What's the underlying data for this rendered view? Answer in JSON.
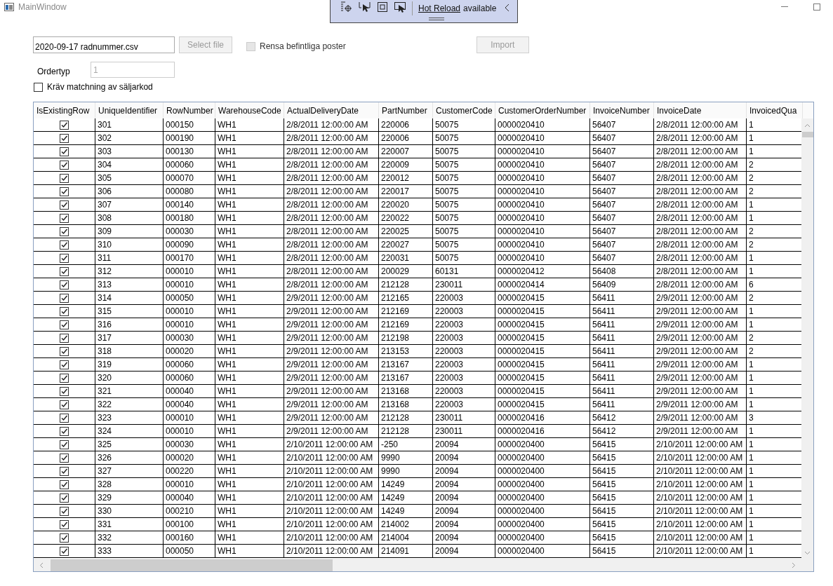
{
  "window": {
    "title": "MainWindow"
  },
  "hot_reload": {
    "link": "Hot Reload",
    "text": "available"
  },
  "file_box": {
    "lines": [
      "2020-09-17 radnummer.csv"
    ]
  },
  "select_button": {
    "label": "Select file",
    "disabled": true
  },
  "clear_option": {
    "label": "Rensa befintliga poster",
    "checked": false,
    "disabled": true
  },
  "import_button": {
    "label": "Import",
    "disabled": true
  },
  "order_type": {
    "label": "Ordertyp",
    "value": "1",
    "disabled": true
  },
  "match_option": {
    "label": "Kräv matchning av säljarkod",
    "checked": false
  },
  "table": {
    "columns": [
      "IsExistingRow",
      "UniqueIdentifier",
      "RowNumber",
      "WarehouseCode",
      "ActualDeliveryDate",
      "PartNumber",
      "CustomerCode",
      "CustomerOrderNumber",
      "InvoiceNumber",
      "InvoiceDate",
      "InvoicedQua"
    ],
    "rows": [
      {
        "checked": true,
        "cells": [
          "",
          "301",
          "000150",
          "WH1",
          "2/8/2011 12:00:00 AM",
          "220006",
          "50075",
          "0000020410",
          "56407",
          "2/8/2011 12:00:00 AM",
          "1"
        ]
      },
      {
        "checked": true,
        "cells": [
          "",
          "302",
          "000190",
          "WH1",
          "2/8/2011 12:00:00 AM",
          "220006",
          "50075",
          "0000020410",
          "56407",
          "2/8/2011 12:00:00 AM",
          "1"
        ]
      },
      {
        "checked": true,
        "cells": [
          "",
          "303",
          "000130",
          "WH1",
          "2/8/2011 12:00:00 AM",
          "220007",
          "50075",
          "0000020410",
          "56407",
          "2/8/2011 12:00:00 AM",
          "1"
        ]
      },
      {
        "checked": true,
        "cells": [
          "",
          "304",
          "000060",
          "WH1",
          "2/8/2011 12:00:00 AM",
          "220009",
          "50075",
          "0000020410",
          "56407",
          "2/8/2011 12:00:00 AM",
          "2"
        ]
      },
      {
        "checked": true,
        "cells": [
          "",
          "305",
          "000070",
          "WH1",
          "2/8/2011 12:00:00 AM",
          "220012",
          "50075",
          "0000020410",
          "56407",
          "2/8/2011 12:00:00 AM",
          "2"
        ]
      },
      {
        "checked": true,
        "cells": [
          "",
          "306",
          "000080",
          "WH1",
          "2/8/2011 12:00:00 AM",
          "220017",
          "50075",
          "0000020410",
          "56407",
          "2/8/2011 12:00:00 AM",
          "2"
        ]
      },
      {
        "checked": true,
        "cells": [
          "",
          "307",
          "000140",
          "WH1",
          "2/8/2011 12:00:00 AM",
          "220020",
          "50075",
          "0000020410",
          "56407",
          "2/8/2011 12:00:00 AM",
          "1"
        ]
      },
      {
        "checked": true,
        "cells": [
          "",
          "308",
          "000180",
          "WH1",
          "2/8/2011 12:00:00 AM",
          "220022",
          "50075",
          "0000020410",
          "56407",
          "2/8/2011 12:00:00 AM",
          "1"
        ]
      },
      {
        "checked": true,
        "cells": [
          "",
          "309",
          "000030",
          "WH1",
          "2/8/2011 12:00:00 AM",
          "220025",
          "50075",
          "0000020410",
          "56407",
          "2/8/2011 12:00:00 AM",
          "2"
        ]
      },
      {
        "checked": true,
        "cells": [
          "",
          "310",
          "000090",
          "WH1",
          "2/8/2011 12:00:00 AM",
          "220027",
          "50075",
          "0000020410",
          "56407",
          "2/8/2011 12:00:00 AM",
          "2"
        ]
      },
      {
        "checked": true,
        "cells": [
          "",
          "311",
          "000170",
          "WH1",
          "2/8/2011 12:00:00 AM",
          "220031",
          "50075",
          "0000020410",
          "56407",
          "2/8/2011 12:00:00 AM",
          "1"
        ]
      },
      {
        "checked": true,
        "cells": [
          "",
          "312",
          "000010",
          "WH1",
          "2/8/2011 12:00:00 AM",
          "200029",
          "60131",
          "0000020412",
          "56408",
          "2/8/2011 12:00:00 AM",
          "1"
        ]
      },
      {
        "checked": true,
        "cells": [
          "",
          "313",
          "000010",
          "WH1",
          "2/8/2011 12:00:00 AM",
          "212128",
          "230011",
          "0000020414",
          "56409",
          "2/8/2011 12:00:00 AM",
          "6"
        ]
      },
      {
        "checked": true,
        "cells": [
          "",
          "314",
          "000050",
          "WH1",
          "2/9/2011 12:00:00 AM",
          "212165",
          "220003",
          "0000020415",
          "56411",
          "2/9/2011 12:00:00 AM",
          "2"
        ]
      },
      {
        "checked": true,
        "cells": [
          "",
          "315",
          "000010",
          "WH1",
          "2/9/2011 12:00:00 AM",
          "212169",
          "220003",
          "0000020415",
          "56411",
          "2/9/2011 12:00:00 AM",
          "1"
        ]
      },
      {
        "checked": true,
        "cells": [
          "",
          "316",
          "000010",
          "WH1",
          "2/9/2011 12:00:00 AM",
          "212169",
          "220003",
          "0000020415",
          "56411",
          "2/9/2011 12:00:00 AM",
          "1"
        ]
      },
      {
        "checked": true,
        "cells": [
          "",
          "317",
          "000030",
          "WH1",
          "2/9/2011 12:00:00 AM",
          "212198",
          "220003",
          "0000020415",
          "56411",
          "2/9/2011 12:00:00 AM",
          "2"
        ]
      },
      {
        "checked": true,
        "cells": [
          "",
          "318",
          "000020",
          "WH1",
          "2/9/2011 12:00:00 AM",
          "213153",
          "220003",
          "0000020415",
          "56411",
          "2/9/2011 12:00:00 AM",
          "2"
        ]
      },
      {
        "checked": true,
        "cells": [
          "",
          "319",
          "000060",
          "WH1",
          "2/9/2011 12:00:00 AM",
          "213167",
          "220003",
          "0000020415",
          "56411",
          "2/9/2011 12:00:00 AM",
          "1"
        ]
      },
      {
        "checked": true,
        "cells": [
          "",
          "320",
          "000060",
          "WH1",
          "2/9/2011 12:00:00 AM",
          "213167",
          "220003",
          "0000020415",
          "56411",
          "2/9/2011 12:00:00 AM",
          "1"
        ]
      },
      {
        "checked": true,
        "cells": [
          "",
          "321",
          "000040",
          "WH1",
          "2/9/2011 12:00:00 AM",
          "213168",
          "220003",
          "0000020415",
          "56411",
          "2/9/2011 12:00:00 AM",
          "1"
        ]
      },
      {
        "checked": true,
        "cells": [
          "",
          "322",
          "000040",
          "WH1",
          "2/9/2011 12:00:00 AM",
          "213168",
          "220003",
          "0000020415",
          "56411",
          "2/9/2011 12:00:00 AM",
          "1"
        ]
      },
      {
        "checked": true,
        "cells": [
          "",
          "323",
          "000010",
          "WH1",
          "2/9/2011 12:00:00 AM",
          "212128",
          "230011",
          "0000020416",
          "56412",
          "2/9/2011 12:00:00 AM",
          "3"
        ]
      },
      {
        "checked": true,
        "cells": [
          "",
          "324",
          "000010",
          "WH1",
          "2/9/2011 12:00:00 AM",
          "212128",
          "230011",
          "0000020416",
          "56412",
          "2/9/2011 12:00:00 AM",
          "1"
        ]
      },
      {
        "checked": true,
        "cells": [
          "",
          "325",
          "000030",
          "WH1",
          "2/10/2011 12:00:00 AM",
          "-250",
          "20094",
          "0000020400",
          "56415",
          "2/10/2011 12:00:00 AM",
          "1"
        ]
      },
      {
        "checked": true,
        "cells": [
          "",
          "326",
          "000020",
          "WH1",
          "2/10/2011 12:00:00 AM",
          "9990",
          "20094",
          "0000020400",
          "56415",
          "2/10/2011 12:00:00 AM",
          "1"
        ]
      },
      {
        "checked": true,
        "cells": [
          "",
          "327",
          "000220",
          "WH1",
          "2/10/2011 12:00:00 AM",
          "9990",
          "20094",
          "0000020400",
          "56415",
          "2/10/2011 12:00:00 AM",
          "1"
        ]
      },
      {
        "checked": true,
        "cells": [
          "",
          "328",
          "000010",
          "WH1",
          "2/10/2011 12:00:00 AM",
          "14249",
          "20094",
          "0000020400",
          "56415",
          "2/10/2011 12:00:00 AM",
          "1"
        ]
      },
      {
        "checked": true,
        "cells": [
          "",
          "329",
          "000040",
          "WH1",
          "2/10/2011 12:00:00 AM",
          "14249",
          "20094",
          "0000020400",
          "56415",
          "2/10/2011 12:00:00 AM",
          "1"
        ]
      },
      {
        "checked": true,
        "cells": [
          "",
          "330",
          "000210",
          "WH1",
          "2/10/2011 12:00:00 AM",
          "14249",
          "20094",
          "0000020400",
          "56415",
          "2/10/2011 12:00:00 AM",
          "1"
        ]
      },
      {
        "checked": true,
        "cells": [
          "",
          "331",
          "000100",
          "WH1",
          "2/10/2011 12:00:00 AM",
          "214002",
          "20094",
          "0000020400",
          "56415",
          "2/10/2011 12:00:00 AM",
          "1"
        ]
      },
      {
        "checked": true,
        "cells": [
          "",
          "332",
          "000160",
          "WH1",
          "2/10/2011 12:00:00 AM",
          "214004",
          "20094",
          "0000020400",
          "56415",
          "2/10/2011 12:00:00 AM",
          "1"
        ]
      },
      {
        "checked": true,
        "cells": [
          "",
          "333",
          "000050",
          "WH1",
          "2/10/2011 12:00:00 AM",
          "214091",
          "20094",
          "0000020400",
          "56415",
          "2/10/2011 12:00:00 AM",
          "1"
        ]
      }
    ]
  }
}
